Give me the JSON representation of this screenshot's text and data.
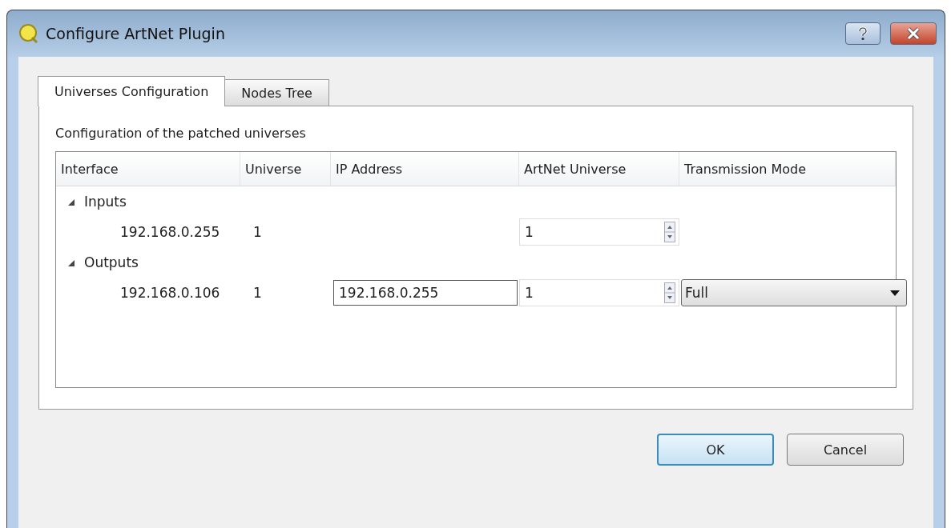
{
  "window": {
    "title": "Configure ArtNet Plugin"
  },
  "tabs": [
    {
      "label": "Universes Configuration",
      "selected": true
    },
    {
      "label": "Nodes Tree",
      "selected": false
    }
  ],
  "description": "Configuration of the patched universes",
  "tree": {
    "columns": [
      "Interface",
      "Universe",
      "IP Address",
      "ArtNet Universe",
      "Transmission Mode"
    ],
    "groups": [
      {
        "label": "Inputs",
        "expanded": true,
        "children": [
          {
            "interface": "192.168.0.255",
            "universe": "1",
            "artnet_universe": "1"
          }
        ]
      },
      {
        "label": "Outputs",
        "expanded": true,
        "children": [
          {
            "interface": "192.168.0.106",
            "universe": "1",
            "ip_address": "192.168.0.255",
            "artnet_universe": "1",
            "transmission_mode": "Full"
          }
        ]
      }
    ]
  },
  "buttons": [
    {
      "label": "OK",
      "default": true
    },
    {
      "label": "Cancel",
      "default": false
    }
  ]
}
